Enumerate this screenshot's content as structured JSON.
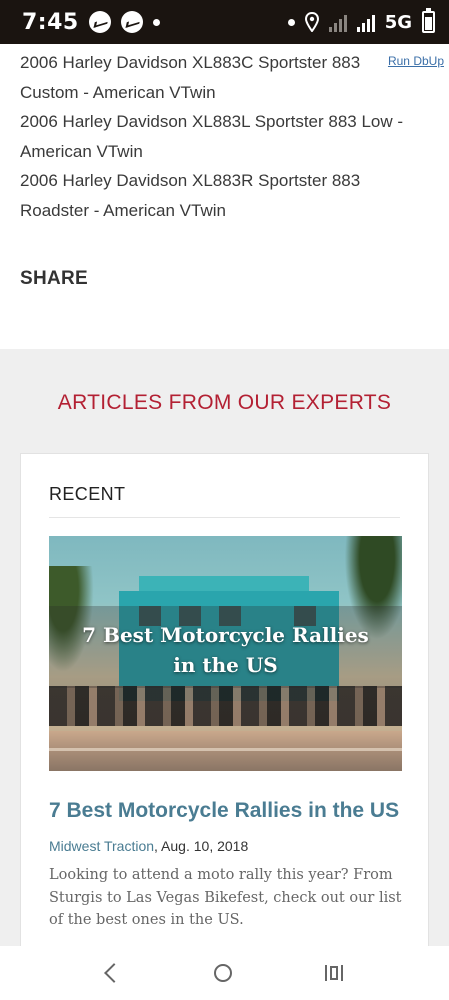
{
  "status_bar": {
    "time": "7:45",
    "network": "5G"
  },
  "models": [
    "2006 Harley Davidson XL883C Sportster 883",
    "Custom - American VTwin",
    "2006 Harley Davidson XL883L Sportster 883 Low -",
    "American VTwin",
    "2006 Harley Davidson XL883R Sportster 883",
    "Roadster - American VTwin"
  ],
  "run_link": "Run DbUp",
  "share_label": "SHARE",
  "articles": {
    "heading": "ARTICLES FROM OUR EXPERTS",
    "card_label": "RECENT",
    "image_title_line1": "7 Best Motorcycle Rallies",
    "image_title_line2": "in the US",
    "title": "7 Best Motorcycle Rallies in the US",
    "author": "Midwest Traction",
    "date": ", Aug. 10, 2018",
    "excerpt": "Looking to attend a moto rally this year? From Sturgis to Las Vegas Bikefest, check out our list of the best ones in the US."
  },
  "colors": {
    "accent_red": "#b32033",
    "link_blue": "#4a7c92",
    "section_bg": "#efefef"
  },
  "nav": {
    "back_icon": "back-chevron-icon",
    "home_icon": "home-circle-icon",
    "recents_icon": "recents-icon"
  }
}
